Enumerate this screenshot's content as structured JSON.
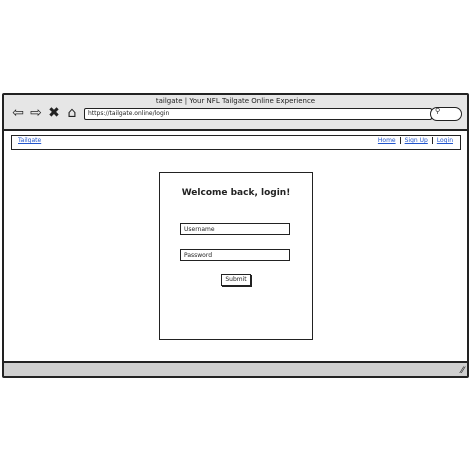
{
  "window": {
    "title": "tailgate | Your NFL Tailgate Online Experience",
    "url": "https://tailgate.online/login",
    "nav_icons": [
      "back-arrow-icon",
      "forward-arrow-icon",
      "close-icon",
      "home-icon"
    ],
    "search_icon": "search-icon"
  },
  "navbar": {
    "brand": "Tailgate",
    "links": [
      "Home",
      "Sign Up",
      "Login"
    ]
  },
  "login": {
    "heading": "Welcome back, login!",
    "username_placeholder": "Username",
    "password_placeholder": "Password",
    "submit_label": "Submit"
  }
}
